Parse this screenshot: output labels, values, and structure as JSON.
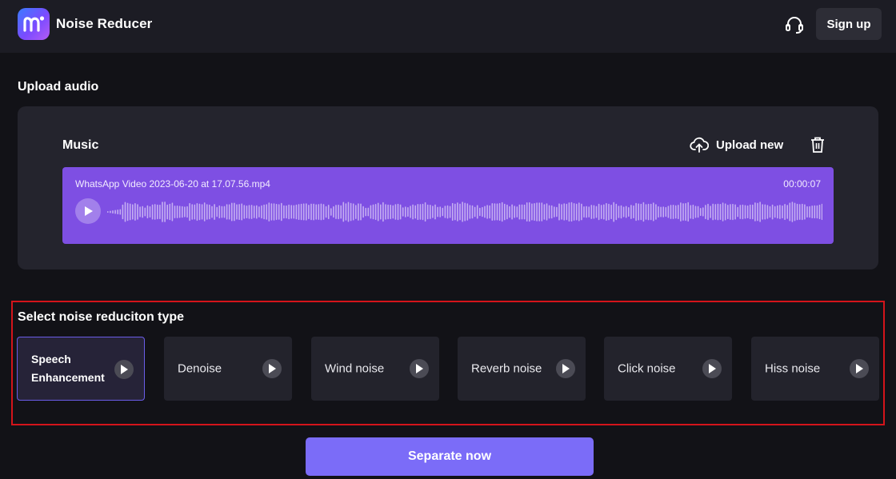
{
  "header": {
    "app_title": "Noise Reducer",
    "signup_label": "Sign up",
    "support_icon": "headset-icon",
    "logo_icon": "media-io-logo"
  },
  "upload": {
    "section_title": "Upload audio",
    "music_label": "Music",
    "upload_new_label": "Upload new",
    "file_name": "WhatsApp Video 2023-06-20 at 17.07.56.mp4",
    "duration": "00:00:07"
  },
  "noise_types": {
    "section_title": "Select noise reduciton type",
    "selected_index": 0,
    "items": [
      {
        "label": "Speech Enhancement"
      },
      {
        "label": "Denoise"
      },
      {
        "label": "Wind noise"
      },
      {
        "label": "Reverb noise"
      },
      {
        "label": "Click noise"
      },
      {
        "label": "Hiss noise"
      }
    ]
  },
  "action": {
    "separate_label": "Separate now"
  },
  "colors": {
    "background": "#121217",
    "header_bg": "#1c1c24",
    "card_bg": "#24242d",
    "track_bg": "#7e4fe3",
    "accent": "#7b6cf8",
    "highlight_border": "#d4141b"
  }
}
